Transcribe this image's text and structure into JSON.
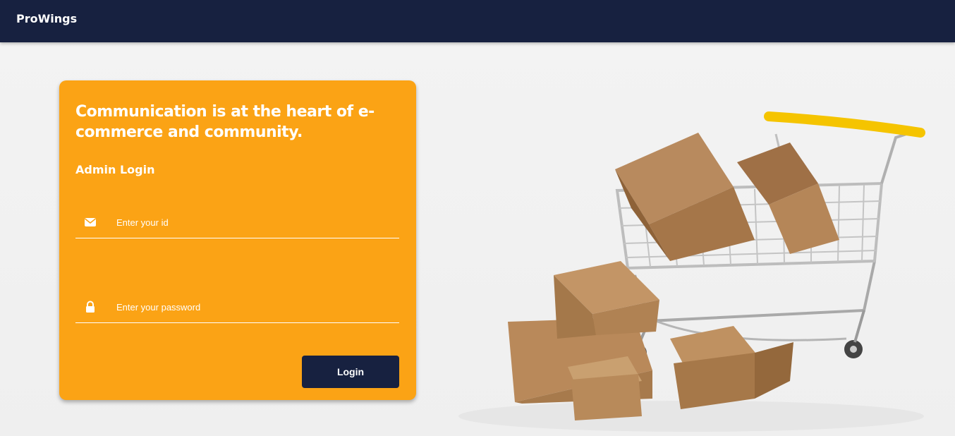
{
  "navbar": {
    "brand": "ProWings"
  },
  "login_card": {
    "headline": "Communication is at the heart of e-commerce and community.",
    "subtitle": "Admin Login",
    "id_field": {
      "placeholder": "Enter your id",
      "value": "",
      "icon": "envelope-icon"
    },
    "password_field": {
      "placeholder": "Enter your password",
      "value": "",
      "icon": "lock-icon"
    },
    "login_button": "Login"
  },
  "illustration": {
    "subject": "shopping-cart-with-boxes"
  },
  "colors": {
    "navbar": "#172140",
    "card": "#fba315",
    "button": "#172140",
    "text": "#ffffff"
  }
}
